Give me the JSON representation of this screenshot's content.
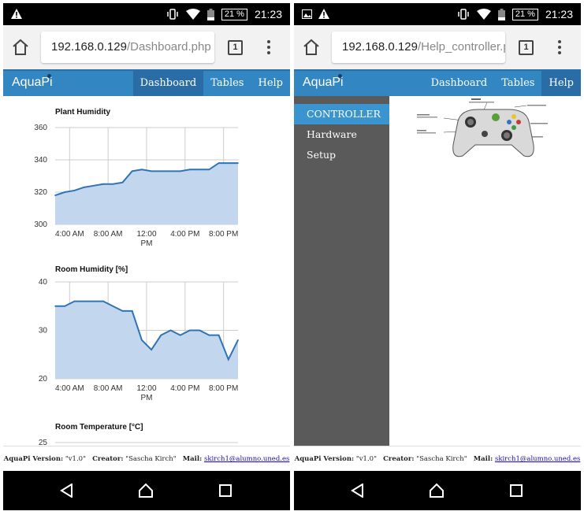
{
  "status_bar": {
    "time": "21:23",
    "battery": "21 %",
    "icons": [
      "warning-icon",
      "vibrate-icon",
      "wifi-icon",
      "battery-icon"
    ],
    "right_screen_extra_icon": "image-icon"
  },
  "left_screen": {
    "url_host": "192.168.0.129",
    "url_path": "/Dashboard.php",
    "tab_count": "1",
    "brand": "AquaPi",
    "nav": [
      "Dashboard",
      "Tables",
      "Help"
    ],
    "active_nav": "Dashboard",
    "footer": {
      "version_label": "AquaPi Version:",
      "version_value": "\"v1.0\"",
      "creator_label": "Creator:",
      "creator_value": "\"Sascha Kirch\"",
      "mail_label": "Mail:",
      "mail_value": "skirch1@alumno.uned.es"
    }
  },
  "right_screen": {
    "url_host": "192.168.0.129",
    "url_path": "/Help_controller.pl",
    "tab_count": "1",
    "brand": "AquaPi",
    "nav": [
      "Dashboard",
      "Tables",
      "Help"
    ],
    "active_nav": "Help",
    "sidebar": [
      "CONTROLLER",
      "Hardware Setup"
    ],
    "footer": {
      "version_label": "AquaPi Version:",
      "version_value": "\"v1.0\"",
      "creator_label": "Creator:",
      "creator_value": "\"Sascha Kirch\"",
      "mail_label": "Mail:",
      "mail_value": "skirch1@alumno.uned.es"
    }
  },
  "colors": {
    "navbar": "#3287c2",
    "nav_active": "#2a6da6",
    "line": "#2f74b5",
    "area": "#c2d7ee",
    "sidebar": "#5a5a5a",
    "sidebar_active": "#3a94cf"
  },
  "chart_data": [
    {
      "type": "area",
      "title": "Plant Humidity",
      "x_ticks": [
        "4:00 AM",
        "8:00 AM",
        "12:00 PM",
        "4:00 PM",
        "8:00 PM"
      ],
      "x_tick_hours": [
        4,
        8,
        12,
        16,
        20
      ],
      "xlim_hours": [
        2.5,
        21.5
      ],
      "y_ticks": [
        300,
        320,
        340,
        360
      ],
      "ylim": [
        300,
        360
      ],
      "x": [
        2.5,
        3.5,
        4.5,
        5.5,
        6.5,
        7.5,
        8.5,
        9.5,
        10.5,
        11.5,
        12.5,
        13.5,
        14.5,
        15.5,
        16.5,
        17.5,
        18.5,
        19.5,
        20.5,
        21.5
      ],
      "y": [
        318,
        320,
        321,
        323,
        324,
        325,
        325,
        326,
        333,
        334,
        333,
        333,
        333,
        333,
        334,
        334,
        334,
        338,
        338,
        338
      ]
    },
    {
      "type": "area",
      "title": "Room Humidity [%]",
      "x_ticks": [
        "4:00 AM",
        "8:00 AM",
        "12:00 PM",
        "4:00 PM",
        "8:00 PM"
      ],
      "x_tick_hours": [
        4,
        8,
        12,
        16,
        20
      ],
      "xlim_hours": [
        2.5,
        21.5
      ],
      "y_ticks": [
        20,
        30,
        40
      ],
      "ylim": [
        20,
        40
      ],
      "x": [
        2.5,
        3.5,
        4.5,
        5.5,
        6.5,
        7.5,
        8.5,
        9.5,
        10.5,
        11.5,
        12.5,
        13.5,
        14.5,
        15.5,
        16.5,
        17.5,
        18.5,
        19.5,
        20.5,
        21.5
      ],
      "y": [
        35,
        35,
        36,
        36,
        36,
        36,
        35,
        34,
        34,
        28,
        26,
        29,
        30,
        29,
        30,
        30,
        29,
        29,
        24,
        28
      ]
    },
    {
      "type": "line",
      "title": "Room Temperature [°C]",
      "y_ticks": [
        25
      ],
      "x": [],
      "y": []
    }
  ]
}
